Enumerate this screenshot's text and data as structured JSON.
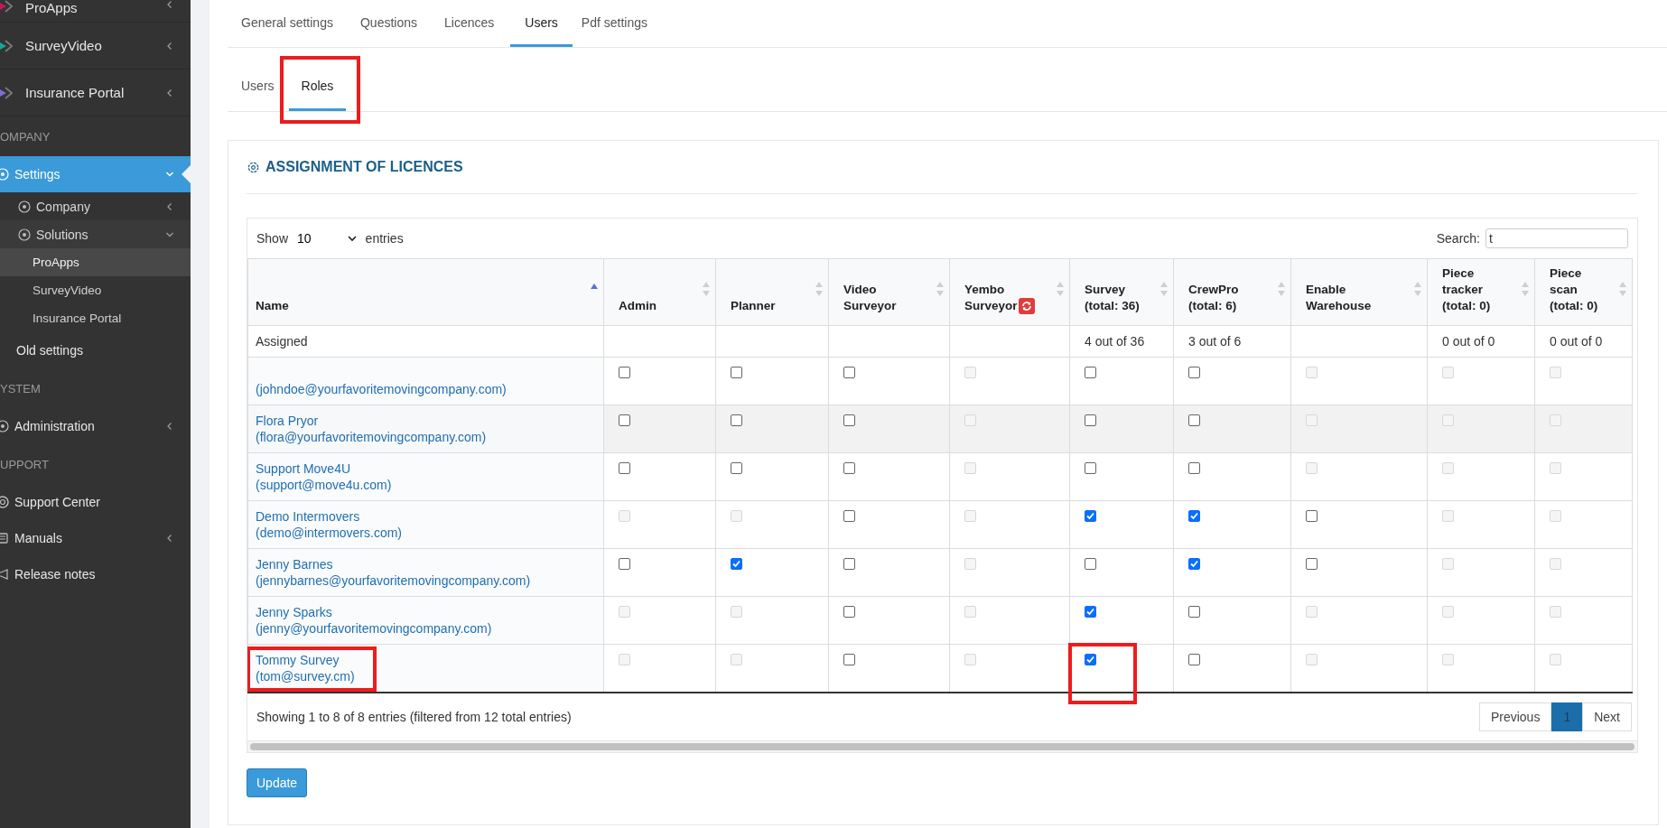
{
  "sidebar": {
    "items": [
      {
        "kind": "app",
        "label": "ProApps",
        "color": "#c2185b",
        "expanded": false
      },
      {
        "kind": "app",
        "label": "SurveyVideo",
        "color": "#1aa39a",
        "expanded": false
      },
      {
        "kind": "app",
        "label": "Insurance Portal",
        "color": "#7b6fd0",
        "expanded": false
      },
      {
        "kind": "header",
        "label": "OMPANY"
      },
      {
        "kind": "item",
        "label": "Settings",
        "expanded": true,
        "selected": true
      },
      {
        "kind": "subitem",
        "label": "Company",
        "expanded": false
      },
      {
        "kind": "subitem",
        "label": "Solutions",
        "expanded": true
      },
      {
        "kind": "subsubitem",
        "label": "ProApps",
        "selected": true
      },
      {
        "kind": "subsubitem",
        "label": "SurveyVideo",
        "selected": false
      },
      {
        "kind": "subsubitem",
        "label": "Insurance Portal",
        "selected": false
      },
      {
        "kind": "item",
        "label": "Old settings",
        "selected": false
      },
      {
        "kind": "header",
        "label": "YSTEM"
      },
      {
        "kind": "item",
        "label": "Administration",
        "expanded": false,
        "selected": false
      },
      {
        "kind": "header",
        "label": "UPPORT"
      },
      {
        "kind": "item",
        "label": "Support Center",
        "selected": false
      },
      {
        "kind": "item",
        "label": "Manuals",
        "expanded": false,
        "selected": false
      },
      {
        "kind": "item",
        "label": "Release notes",
        "selected": false
      }
    ]
  },
  "tabs": [
    {
      "label": "General settings",
      "selected": false
    },
    {
      "label": "Questions",
      "selected": false
    },
    {
      "label": "Licences",
      "selected": false
    },
    {
      "label": "Users",
      "selected": true
    },
    {
      "label": "Pdf settings",
      "selected": false
    }
  ],
  "subtabs": [
    {
      "label": "Users",
      "selected": false,
      "annotated": false
    },
    {
      "label": "Roles",
      "selected": true,
      "annotated": true
    }
  ],
  "card": {
    "title": "ASSIGNMENT OF LICENCES",
    "show": {
      "prefix": "Show",
      "value": "10",
      "suffix": "entries"
    },
    "search": {
      "label": "Search:",
      "value": "t"
    },
    "assigned_label": "Assigned",
    "columns": [
      {
        "lines": [
          "Name"
        ],
        "sorted": true
      },
      {
        "lines": [
          "Admin"
        ],
        "sorted": false
      },
      {
        "lines": [
          "Planner"
        ],
        "sorted": false
      },
      {
        "lines": [
          "Video",
          "Surveyor"
        ],
        "sorted": false
      },
      {
        "lines": [
          "Yembo",
          "Surveyor"
        ],
        "sorted": false,
        "kind": "refresh"
      },
      {
        "lines": [
          "Survey",
          "(total: 36)"
        ],
        "sorted": false,
        "assigned": "4 out of 36"
      },
      {
        "lines": [
          "CrewPro",
          "(total: 6)"
        ],
        "sorted": false,
        "assigned": "3 out of 6"
      },
      {
        "lines": [
          "Enable",
          "Warehouse"
        ],
        "sorted": false
      },
      {
        "lines": [
          "Piece",
          "tracker",
          "(total: 0)"
        ],
        "sorted": false,
        "assigned": "0 out of 0"
      },
      {
        "lines": [
          "Piece",
          "scan",
          "(total: 0)"
        ],
        "sorted": false,
        "assigned": "0 out of 0"
      }
    ],
    "rows": [
      {
        "email": "(johndoe@yourfavoritemovingcompany.com)",
        "hovered": false,
        "annotated": false,
        "cells": [
          {
            "checked": false,
            "disabled": false
          },
          {
            "checked": false,
            "disabled": false
          },
          {
            "checked": false,
            "disabled": false
          },
          {
            "checked": false,
            "disabled": true
          },
          {
            "checked": false,
            "disabled": false,
            "annotated": false
          },
          {
            "checked": false,
            "disabled": false
          },
          {
            "checked": false,
            "disabled": true
          },
          {
            "checked": false,
            "disabled": true
          },
          {
            "checked": false,
            "disabled": true
          }
        ]
      },
      {
        "name": "Flora Pryor",
        "email": "(flora@yourfavoritemovingcompany.com)",
        "hovered": true,
        "annotated": false,
        "cells": [
          {
            "checked": false,
            "disabled": false
          },
          {
            "checked": false,
            "disabled": false
          },
          {
            "checked": false,
            "disabled": false
          },
          {
            "checked": false,
            "disabled": true
          },
          {
            "checked": false,
            "disabled": false,
            "annotated": false
          },
          {
            "checked": false,
            "disabled": false
          },
          {
            "checked": false,
            "disabled": true
          },
          {
            "checked": false,
            "disabled": true
          },
          {
            "checked": false,
            "disabled": true
          }
        ]
      },
      {
        "name": "Support Move4U",
        "email": "(support@move4u.com)",
        "hovered": false,
        "annotated": false,
        "cells": [
          {
            "checked": false,
            "disabled": false
          },
          {
            "checked": false,
            "disabled": false
          },
          {
            "checked": false,
            "disabled": false
          },
          {
            "checked": false,
            "disabled": true
          },
          {
            "checked": false,
            "disabled": false,
            "annotated": false
          },
          {
            "checked": false,
            "disabled": false
          },
          {
            "checked": false,
            "disabled": true
          },
          {
            "checked": false,
            "disabled": true
          },
          {
            "checked": false,
            "disabled": true
          }
        ]
      },
      {
        "name": "Demo Intermovers",
        "email": "(demo@intermovers.com)",
        "hovered": false,
        "annotated": false,
        "cells": [
          {
            "checked": false,
            "disabled": true
          },
          {
            "checked": false,
            "disabled": true
          },
          {
            "checked": false,
            "disabled": false
          },
          {
            "checked": false,
            "disabled": true
          },
          {
            "checked": true,
            "disabled": false,
            "annotated": false
          },
          {
            "checked": true,
            "disabled": false
          },
          {
            "checked": false,
            "disabled": false
          },
          {
            "checked": false,
            "disabled": true
          },
          {
            "checked": false,
            "disabled": true
          }
        ]
      },
      {
        "name": "Jenny Barnes",
        "email": "(jennybarnes@yourfavoritemovingcompany.com)",
        "hovered": false,
        "annotated": false,
        "cells": [
          {
            "checked": false,
            "disabled": false
          },
          {
            "checked": true,
            "disabled": false
          },
          {
            "checked": false,
            "disabled": false
          },
          {
            "checked": false,
            "disabled": true
          },
          {
            "checked": false,
            "disabled": false,
            "annotated": false
          },
          {
            "checked": true,
            "disabled": false
          },
          {
            "checked": false,
            "disabled": false
          },
          {
            "checked": false,
            "disabled": true
          },
          {
            "checked": false,
            "disabled": true
          }
        ]
      },
      {
        "name": "Jenny Sparks",
        "email": "(jenny@yourfavoritemovingcompany.com)",
        "hovered": false,
        "annotated": false,
        "cells": [
          {
            "checked": false,
            "disabled": true
          },
          {
            "checked": false,
            "disabled": true
          },
          {
            "checked": false,
            "disabled": false
          },
          {
            "checked": false,
            "disabled": true
          },
          {
            "checked": true,
            "disabled": false,
            "annotated": false
          },
          {
            "checked": false,
            "disabled": false
          },
          {
            "checked": false,
            "disabled": true
          },
          {
            "checked": false,
            "disabled": true
          },
          {
            "checked": false,
            "disabled": true
          }
        ]
      },
      {
        "name": "Tommy Survey",
        "email": "(tom@survey.cm)",
        "hovered": false,
        "annotated": true,
        "cells": [
          {
            "checked": false,
            "disabled": true
          },
          {
            "checked": false,
            "disabled": true
          },
          {
            "checked": false,
            "disabled": false
          },
          {
            "checked": false,
            "disabled": true
          },
          {
            "checked": true,
            "disabled": false,
            "annotated": true
          },
          {
            "checked": false,
            "disabled": false
          },
          {
            "checked": false,
            "disabled": true
          },
          {
            "checked": false,
            "disabled": true
          },
          {
            "checked": false,
            "disabled": true
          }
        ]
      }
    ],
    "info": "Showing 1 to 8 of 8 entries (filtered from 12 total entries)",
    "pagination": {
      "previous": "Previous",
      "pages": [
        {
          "label": "1",
          "selected": true
        }
      ],
      "next": "Next"
    },
    "button": "Update"
  }
}
